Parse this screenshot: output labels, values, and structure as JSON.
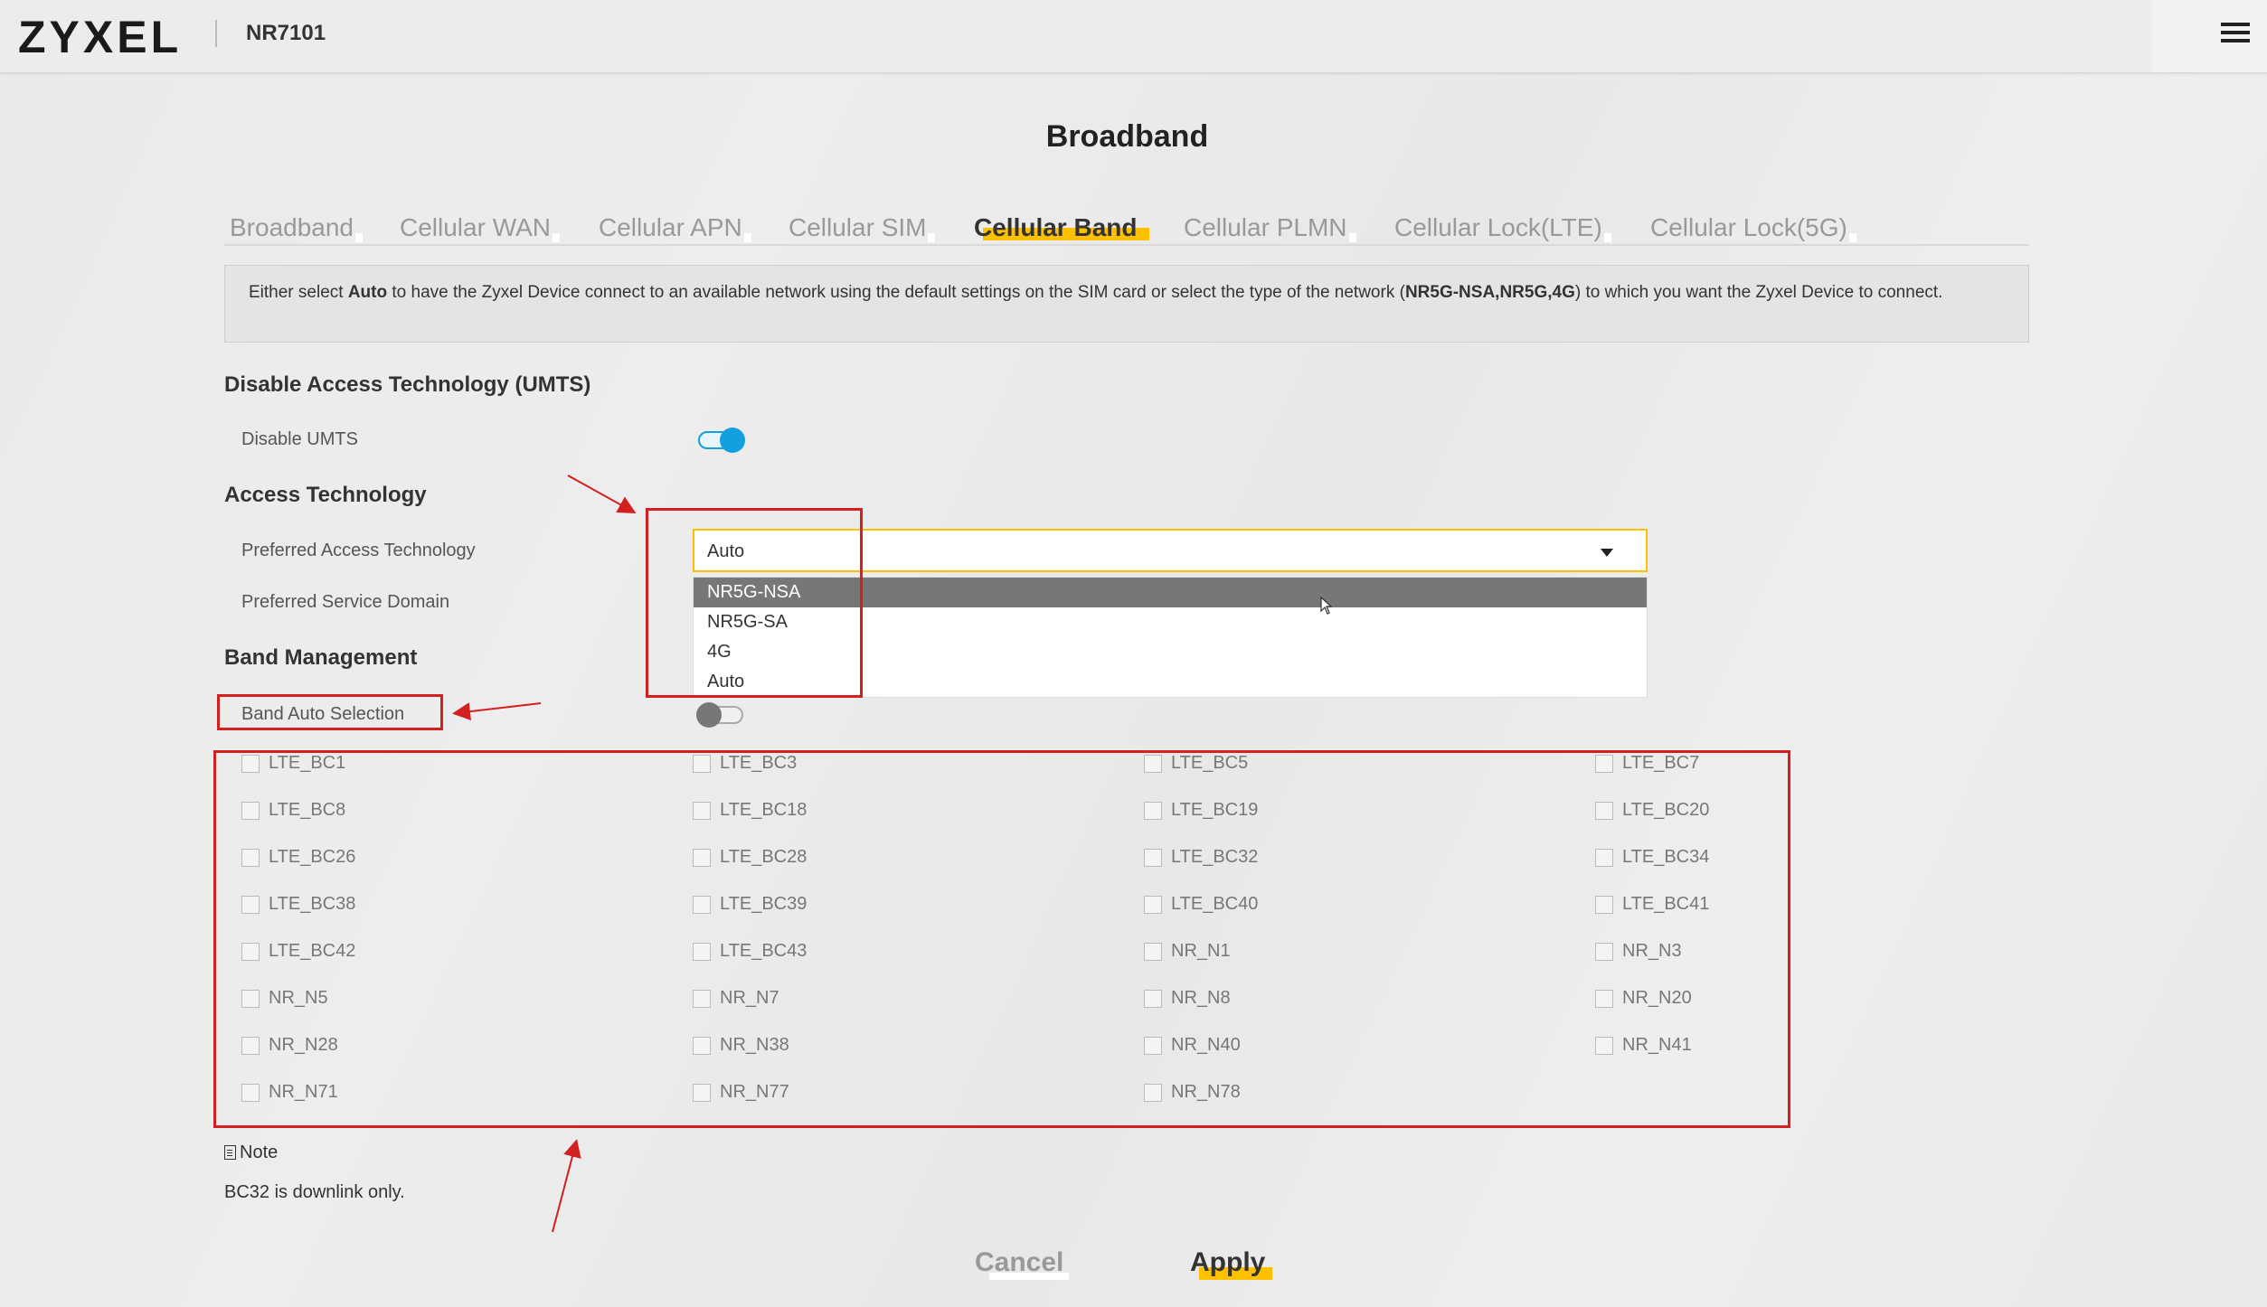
{
  "header": {
    "brand": "ZYXEL",
    "model": "NR7101",
    "menu_icon": "hamburger-icon"
  },
  "page_title": "Broadband",
  "tabs": [
    {
      "label": "Broadband",
      "active": false
    },
    {
      "label": "Cellular WAN",
      "active": false
    },
    {
      "label": "Cellular APN",
      "active": false
    },
    {
      "label": "Cellular SIM",
      "active": false
    },
    {
      "label": "Cellular Band",
      "active": true
    },
    {
      "label": "Cellular PLMN",
      "active": false
    },
    {
      "label": "Cellular Lock(LTE)",
      "active": false
    },
    {
      "label": "Cellular Lock(5G)",
      "active": false
    }
  ],
  "info": {
    "part1": "Either select ",
    "bold1": "Auto",
    "part2": " to have the Zyxel Device connect to an available network using the default settings on the SIM card or select the type of the network (",
    "bold2": "NR5G-NSA,NR5G,4G",
    "part3": ") to which you want the Zyxel Device to connect."
  },
  "umts": {
    "section_title": "Disable Access Technology (UMTS)",
    "disable_label": "Disable UMTS",
    "disable_on": true
  },
  "access": {
    "section_title": "Access Technology",
    "preferred_label": "Preferred Access Technology",
    "preferred_value": "Auto",
    "service_domain_label": "Preferred Service Domain",
    "options": [
      "NR5G-NSA",
      "NR5G-SA",
      "4G",
      "Auto"
    ],
    "highlighted_option": "NR5G-NSA"
  },
  "band_mgmt": {
    "section_title": "Band Management",
    "auto_label": "Band Auto Selection",
    "auto_on": false,
    "bands": [
      [
        "LTE_BC1",
        "LTE_BC3",
        "LTE_BC5",
        "LTE_BC7"
      ],
      [
        "LTE_BC8",
        "LTE_BC18",
        "LTE_BC19",
        "LTE_BC20"
      ],
      [
        "LTE_BC26",
        "LTE_BC28",
        "LTE_BC32",
        "LTE_BC34"
      ],
      [
        "LTE_BC38",
        "LTE_BC39",
        "LTE_BC40",
        "LTE_BC41"
      ],
      [
        "LTE_BC42",
        "LTE_BC43",
        "NR_N1",
        "NR_N3"
      ],
      [
        "NR_N5",
        "NR_N7",
        "NR_N8",
        "NR_N20"
      ],
      [
        "NR_N28",
        "NR_N38",
        "NR_N40",
        "NR_N41"
      ],
      [
        "NR_N71",
        "NR_N77",
        "NR_N78"
      ]
    ]
  },
  "note": {
    "heading": "Note",
    "text": "BC32 is downlink only."
  },
  "buttons": {
    "cancel": "Cancel",
    "apply": "Apply"
  },
  "colors": {
    "accent": "#ffc000",
    "toggle_on": "#12a0e0",
    "annotation": "#d21f1f"
  }
}
